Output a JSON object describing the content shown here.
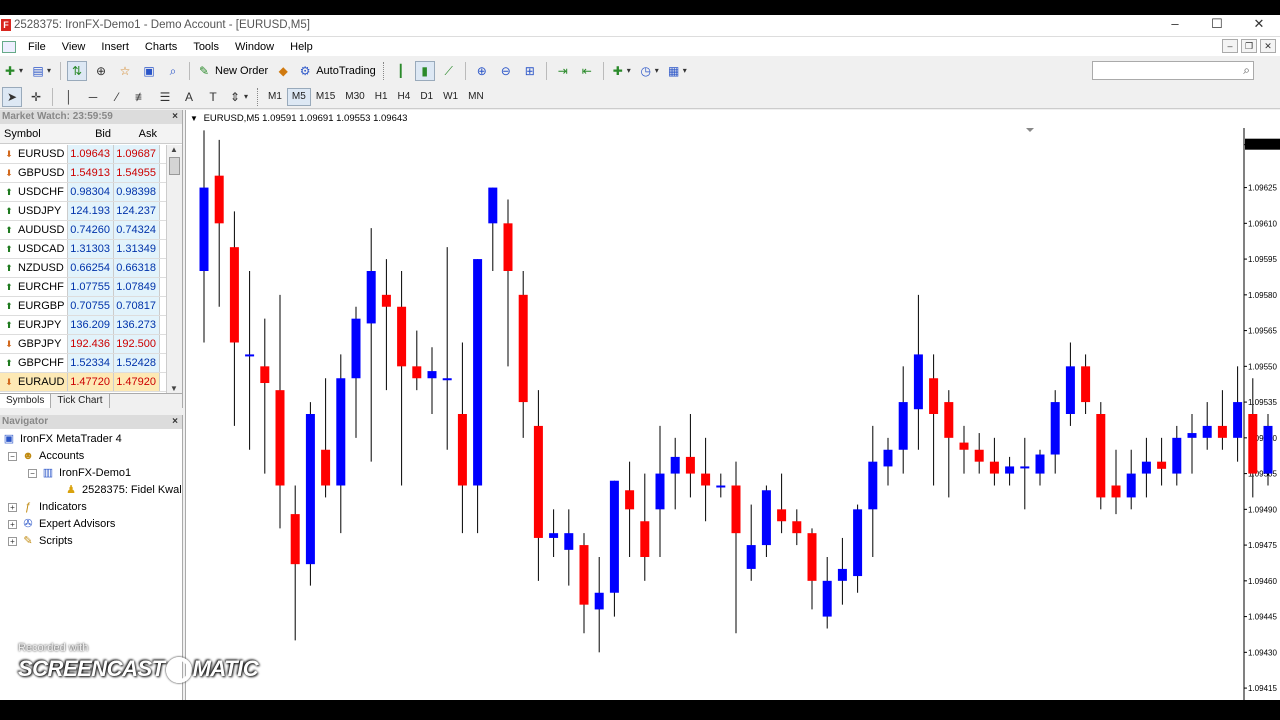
{
  "window": {
    "title": "2528375: IronFX-Demo1 - Demo Account - [EURUSD,M5]",
    "controls": [
      "–",
      "☐",
      "✕"
    ],
    "mdi_controls": [
      "–",
      "❐",
      "✕"
    ]
  },
  "menu": [
    "File",
    "View",
    "Insert",
    "Charts",
    "Tools",
    "Window",
    "Help"
  ],
  "toolbar": {
    "new_order": "New Order",
    "autotrading": "AutoTrading"
  },
  "timeframes": [
    "M1",
    "M5",
    "M15",
    "M30",
    "H1",
    "H4",
    "D1",
    "W1",
    "MN"
  ],
  "timeframe_active": "M5",
  "market_watch": {
    "header": "Market Watch: 23:59:59",
    "columns": [
      "Symbol",
      "Bid",
      "Ask"
    ],
    "rows": [
      {
        "symbol": "EURUSD",
        "bid": "1.09643",
        "ask": "1.09687",
        "dir": "down",
        "bidc": "red",
        "askc": "red"
      },
      {
        "symbol": "GBPUSD",
        "bid": "1.54913",
        "ask": "1.54955",
        "dir": "down",
        "bidc": "red",
        "askc": "red"
      },
      {
        "symbol": "USDCHF",
        "bid": "0.98304",
        "ask": "0.98398",
        "dir": "up",
        "bidc": "blue",
        "askc": "blue"
      },
      {
        "symbol": "USDJPY",
        "bid": "124.193",
        "ask": "124.237",
        "dir": "up",
        "bidc": "blue",
        "askc": "blue"
      },
      {
        "symbol": "AUDUSD",
        "bid": "0.74260",
        "ask": "0.74324",
        "dir": "up",
        "bidc": "blue",
        "askc": "blue"
      },
      {
        "symbol": "USDCAD",
        "bid": "1.31303",
        "ask": "1.31349",
        "dir": "up",
        "bidc": "blue",
        "askc": "blue"
      },
      {
        "symbol": "NZDUSD",
        "bid": "0.66254",
        "ask": "0.66318",
        "dir": "up",
        "bidc": "blue",
        "askc": "blue"
      },
      {
        "symbol": "EURCHF",
        "bid": "1.07755",
        "ask": "1.07849",
        "dir": "up",
        "bidc": "blue",
        "askc": "blue"
      },
      {
        "symbol": "EURGBP",
        "bid": "0.70755",
        "ask": "0.70817",
        "dir": "up",
        "bidc": "blue",
        "askc": "blue"
      },
      {
        "symbol": "EURJPY",
        "bid": "136.209",
        "ask": "136.273",
        "dir": "up",
        "bidc": "blue",
        "askc": "blue"
      },
      {
        "symbol": "GBPJPY",
        "bid": "192.436",
        "ask": "192.500",
        "dir": "down",
        "bidc": "red",
        "askc": "red"
      },
      {
        "symbol": "GBPCHF",
        "bid": "1.52334",
        "ask": "1.52428",
        "dir": "up",
        "bidc": "blue",
        "askc": "blue"
      },
      {
        "symbol": "EURAUD",
        "bid": "1.47720",
        "ask": "1.47920",
        "dir": "down",
        "bidc": "red",
        "askc": "red",
        "selected": true
      }
    ],
    "tabs": [
      "Symbols",
      "Tick Chart"
    ]
  },
  "navigator": {
    "header": "Navigator",
    "root": "IronFX MetaTrader 4",
    "accounts": "Accounts",
    "server": "IronFX-Demo1",
    "account": "2528375: Fidel Kwal",
    "indicators": "Indicators",
    "experts": "Expert Advisors",
    "scripts": "Scripts"
  },
  "chart": {
    "header": "EURUSD,M5  1.09591 1.09691 1.09553 1.09643",
    "current_price": "1.09643",
    "price_labels": [
      "1.09643",
      "1.09625",
      "1.09610",
      "1.09595",
      "1.09580",
      "1.09565",
      "1.09550",
      "1.09535",
      "1.09520",
      "1.09505",
      "1.09490",
      "1.09475",
      "1.09460",
      "1.09445",
      "1.09430",
      "1.09415"
    ]
  },
  "chart_data": {
    "type": "candlestick",
    "title": "EURUSD,M5",
    "ohlc_header": "1.09591 1.09691 1.09553 1.09643",
    "ylim": [
      1.0941,
      1.0965
    ],
    "up_color": "#0000ff",
    "down_color": "#ff0000",
    "candles": [
      {
        "o": 1.0959,
        "h": 1.09649,
        "l": 1.0956,
        "c": 1.09625
      },
      {
        "o": 1.0963,
        "h": 1.09645,
        "l": 1.09575,
        "c": 1.0961
      },
      {
        "o": 1.096,
        "h": 1.09615,
        "l": 1.09525,
        "c": 1.0956
      },
      {
        "o": 1.09555,
        "h": 1.0959,
        "l": 1.09515,
        "c": 1.09555
      },
      {
        "o": 1.0955,
        "h": 1.0957,
        "l": 1.09505,
        "c": 1.09543
      },
      {
        "o": 1.0954,
        "h": 1.0958,
        "l": 1.09482,
        "c": 1.095
      },
      {
        "o": 1.09488,
        "h": 1.095,
        "l": 1.09435,
        "c": 1.09467
      },
      {
        "o": 1.09467,
        "h": 1.09535,
        "l": 1.09458,
        "c": 1.0953
      },
      {
        "o": 1.09515,
        "h": 1.09545,
        "l": 1.09495,
        "c": 1.095
      },
      {
        "o": 1.095,
        "h": 1.09555,
        "l": 1.0948,
        "c": 1.09545
      },
      {
        "o": 1.09545,
        "h": 1.09575,
        "l": 1.0952,
        "c": 1.0957
      },
      {
        "o": 1.09568,
        "h": 1.09608,
        "l": 1.0951,
        "c": 1.0959
      },
      {
        "o": 1.0958,
        "h": 1.09595,
        "l": 1.0954,
        "c": 1.09575
      },
      {
        "o": 1.09575,
        "h": 1.0959,
        "l": 1.095,
        "c": 1.0955
      },
      {
        "o": 1.0955,
        "h": 1.09565,
        "l": 1.0954,
        "c": 1.09545
      },
      {
        "o": 1.09545,
        "h": 1.09558,
        "l": 1.0953,
        "c": 1.09548
      },
      {
        "o": 1.09545,
        "h": 1.096,
        "l": 1.09515,
        "c": 1.09545
      },
      {
        "o": 1.0953,
        "h": 1.0956,
        "l": 1.0948,
        "c": 1.095
      },
      {
        "o": 1.095,
        "h": 1.09595,
        "l": 1.0948,
        "c": 1.09595
      },
      {
        "o": 1.0961,
        "h": 1.09625,
        "l": 1.0959,
        "c": 1.09625
      },
      {
        "o": 1.0961,
        "h": 1.0962,
        "l": 1.0955,
        "c": 1.0959
      },
      {
        "o": 1.0958,
        "h": 1.0959,
        "l": 1.0952,
        "c": 1.09535
      },
      {
        "o": 1.09525,
        "h": 1.0954,
        "l": 1.0946,
        "c": 1.09478
      },
      {
        "o": 1.09478,
        "h": 1.0949,
        "l": 1.0947,
        "c": 1.0948
      },
      {
        "o": 1.09473,
        "h": 1.0949,
        "l": 1.09458,
        "c": 1.0948
      },
      {
        "o": 1.09475,
        "h": 1.0948,
        "l": 1.09438,
        "c": 1.0945
      },
      {
        "o": 1.09448,
        "h": 1.0947,
        "l": 1.0943,
        "c": 1.09455
      },
      {
        "o": 1.09455,
        "h": 1.09502,
        "l": 1.09445,
        "c": 1.09502
      },
      {
        "o": 1.09498,
        "h": 1.0951,
        "l": 1.0947,
        "c": 1.0949
      },
      {
        "o": 1.09485,
        "h": 1.09505,
        "l": 1.0946,
        "c": 1.0947
      },
      {
        "o": 1.0949,
        "h": 1.09525,
        "l": 1.0947,
        "c": 1.09505
      },
      {
        "o": 1.09505,
        "h": 1.0952,
        "l": 1.0949,
        "c": 1.09512
      },
      {
        "o": 1.09512,
        "h": 1.0953,
        "l": 1.09495,
        "c": 1.09505
      },
      {
        "o": 1.09505,
        "h": 1.0952,
        "l": 1.09485,
        "c": 1.095
      },
      {
        "o": 1.095,
        "h": 1.09505,
        "l": 1.09495,
        "c": 1.095
      },
      {
        "o": 1.095,
        "h": 1.0951,
        "l": 1.09438,
        "c": 1.0948
      },
      {
        "o": 1.09465,
        "h": 1.09492,
        "l": 1.0946,
        "c": 1.09475
      },
      {
        "o": 1.09475,
        "h": 1.095,
        "l": 1.0947,
        "c": 1.09498
      },
      {
        "o": 1.0949,
        "h": 1.09505,
        "l": 1.0948,
        "c": 1.09485
      },
      {
        "o": 1.09485,
        "h": 1.0949,
        "l": 1.09475,
        "c": 1.0948
      },
      {
        "o": 1.0948,
        "h": 1.09482,
        "l": 1.09448,
        "c": 1.0946
      },
      {
        "o": 1.09445,
        "h": 1.0947,
        "l": 1.0944,
        "c": 1.0946
      },
      {
        "o": 1.0946,
        "h": 1.09478,
        "l": 1.0945,
        "c": 1.09465
      },
      {
        "o": 1.09462,
        "h": 1.09492,
        "l": 1.09455,
        "c": 1.0949
      },
      {
        "o": 1.0949,
        "h": 1.09525,
        "l": 1.0947,
        "c": 1.0951
      },
      {
        "o": 1.09508,
        "h": 1.0952,
        "l": 1.095,
        "c": 1.09515
      },
      {
        "o": 1.09515,
        "h": 1.0955,
        "l": 1.09505,
        "c": 1.09535
      },
      {
        "o": 1.09532,
        "h": 1.0958,
        "l": 1.09515,
        "c": 1.09555
      },
      {
        "o": 1.09545,
        "h": 1.09555,
        "l": 1.095,
        "c": 1.0953
      },
      {
        "o": 1.09535,
        "h": 1.0954,
        "l": 1.09495,
        "c": 1.0952
      },
      {
        "o": 1.09518,
        "h": 1.09525,
        "l": 1.09505,
        "c": 1.09515
      },
      {
        "o": 1.09515,
        "h": 1.09522,
        "l": 1.09505,
        "c": 1.0951
      },
      {
        "o": 1.0951,
        "h": 1.0952,
        "l": 1.095,
        "c": 1.09505
      },
      {
        "o": 1.09505,
        "h": 1.09512,
        "l": 1.095,
        "c": 1.09508
      },
      {
        "o": 1.09508,
        "h": 1.0952,
        "l": 1.0949,
        "c": 1.09508
      },
      {
        "o": 1.09505,
        "h": 1.09515,
        "l": 1.095,
        "c": 1.09513
      },
      {
        "o": 1.09513,
        "h": 1.0954,
        "l": 1.09505,
        "c": 1.09535
      },
      {
        "o": 1.0953,
        "h": 1.0956,
        "l": 1.09525,
        "c": 1.0955
      },
      {
        "o": 1.0955,
        "h": 1.09555,
        "l": 1.0953,
        "c": 1.09535
      },
      {
        "o": 1.0953,
        "h": 1.09535,
        "l": 1.0949,
        "c": 1.09495
      },
      {
        "o": 1.095,
        "h": 1.09515,
        "l": 1.09488,
        "c": 1.09495
      },
      {
        "o": 1.09495,
        "h": 1.09515,
        "l": 1.0949,
        "c": 1.09505
      },
      {
        "o": 1.09505,
        "h": 1.0952,
        "l": 1.09495,
        "c": 1.0951
      },
      {
        "o": 1.0951,
        "h": 1.0952,
        "l": 1.095,
        "c": 1.09507
      },
      {
        "o": 1.09505,
        "h": 1.09525,
        "l": 1.095,
        "c": 1.0952
      },
      {
        "o": 1.0952,
        "h": 1.0953,
        "l": 1.09505,
        "c": 1.09522
      },
      {
        "o": 1.0952,
        "h": 1.09535,
        "l": 1.09515,
        "c": 1.09525
      },
      {
        "o": 1.09525,
        "h": 1.0954,
        "l": 1.09515,
        "c": 1.0952
      },
      {
        "o": 1.0952,
        "h": 1.0955,
        "l": 1.0951,
        "c": 1.09535
      },
      {
        "o": 1.0953,
        "h": 1.09545,
        "l": 1.09495,
        "c": 1.09505
      },
      {
        "o": 1.09505,
        "h": 1.0953,
        "l": 1.095,
        "c": 1.09525
      }
    ]
  }
}
